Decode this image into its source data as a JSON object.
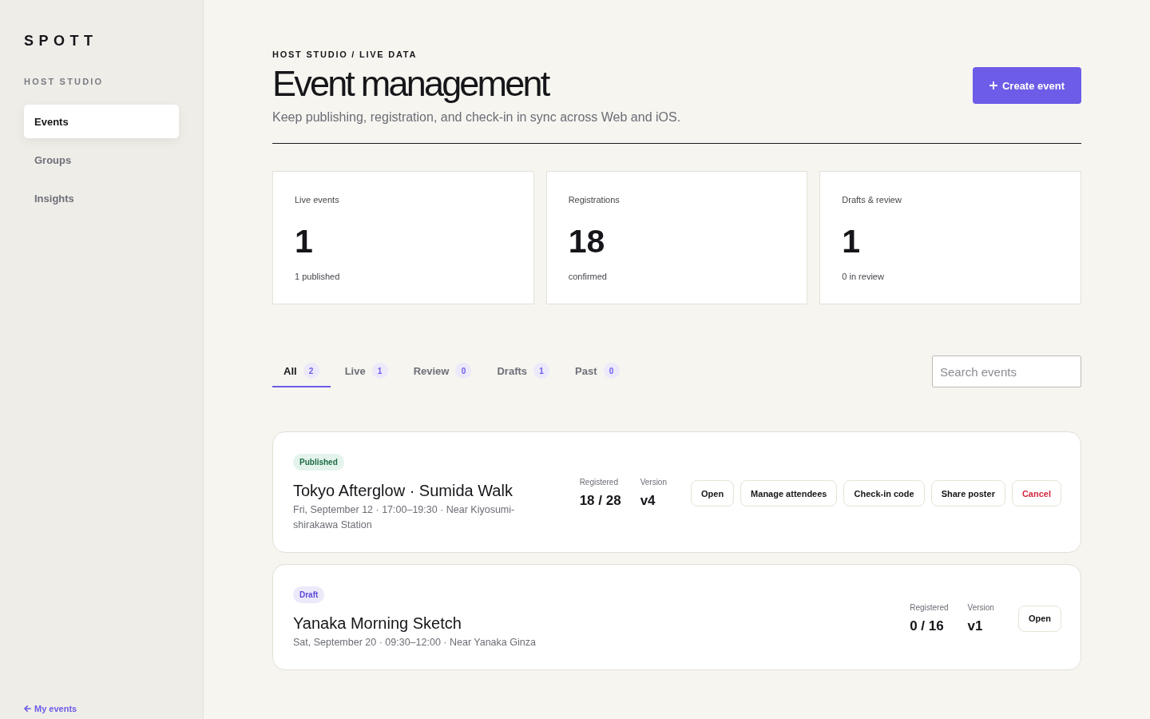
{
  "sidebar": {
    "logo": "SPOTT",
    "section": "HOST STUDIO",
    "items": [
      {
        "label": "Events",
        "selected": true
      },
      {
        "label": "Groups",
        "selected": false
      },
      {
        "label": "Insights",
        "selected": false
      }
    ],
    "footer_link": "My events"
  },
  "header": {
    "breadcrumb": "HOST STUDIO / LIVE DATA",
    "title": "Event management",
    "subtitle": "Keep publishing, registration, and check-in in sync across Web and iOS.",
    "create_button": "Create event"
  },
  "stats": [
    {
      "label": "Live events",
      "value": "1",
      "note": "1 published"
    },
    {
      "label": "Registrations",
      "value": "18",
      "note": "confirmed"
    },
    {
      "label": "Drafts & review",
      "value": "1",
      "note": "0 in review"
    }
  ],
  "tabs": [
    {
      "label": "All",
      "count": "2",
      "selected": true
    },
    {
      "label": "Live",
      "count": "1",
      "selected": false
    },
    {
      "label": "Review",
      "count": "0",
      "selected": false
    },
    {
      "label": "Drafts",
      "count": "1",
      "selected": false
    },
    {
      "label": "Past",
      "count": "0",
      "selected": false
    }
  ],
  "search": {
    "placeholder": "Search events"
  },
  "events": [
    {
      "status": {
        "label": "Published",
        "kind": "published"
      },
      "title": "Tokyo Afterglow · Sumida Walk",
      "meta": "Fri, September 12 · 17:00–19:30 · Near Kiyosumi-shirakawa Station",
      "registered_label": "Registered",
      "registered": "18 / 28",
      "version_label": "Version",
      "version": "v4",
      "actions": [
        {
          "label": "Open",
          "kind": "default"
        },
        {
          "label": "Manage attendees",
          "kind": "default"
        },
        {
          "label": "Check-in code",
          "kind": "default"
        },
        {
          "label": "Share poster",
          "kind": "default"
        },
        {
          "label": "Cancel",
          "kind": "danger"
        }
      ]
    },
    {
      "status": {
        "label": "Draft",
        "kind": "draft"
      },
      "title": "Yanaka Morning Sketch",
      "meta": "Sat, September 20 · 09:30–12:00 · Near Yanaka Ginza",
      "registered_label": "Registered",
      "registered": "0 / 16",
      "version_label": "Version",
      "version": "v1",
      "actions": [
        {
          "label": "Open",
          "kind": "default"
        }
      ]
    }
  ]
}
